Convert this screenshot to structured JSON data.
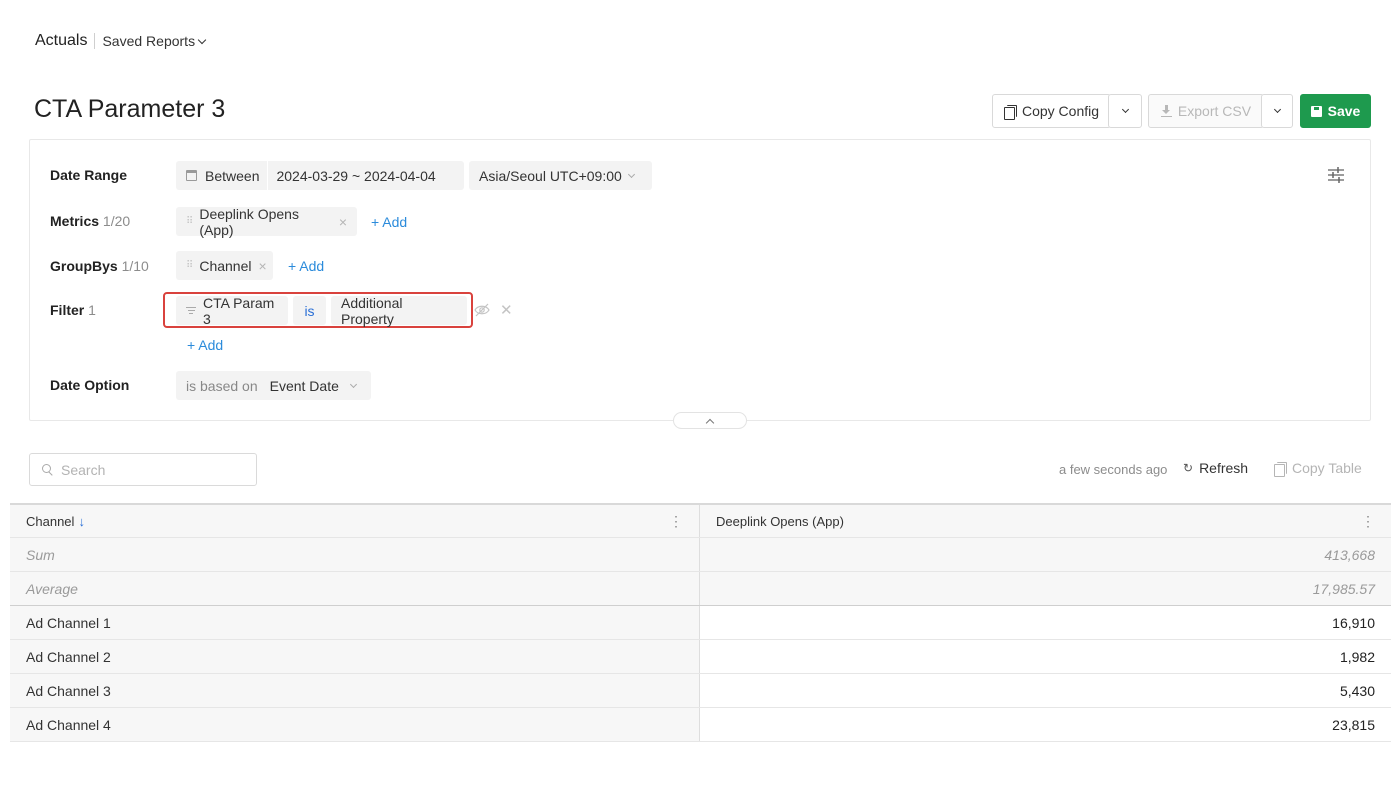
{
  "breadcrumb": {
    "main": "Actuals",
    "saved_reports": "Saved Reports"
  },
  "page_title": "CTA Parameter 3",
  "toolbar": {
    "copy_config": "Copy Config",
    "export_csv": "Export CSV",
    "save": "Save"
  },
  "config": {
    "date_range": {
      "label": "Date Range",
      "mode": "Between",
      "range": "2024-03-29 ~ 2024-04-04",
      "timezone": "Asia/Seoul UTC+09:00"
    },
    "metrics": {
      "label": "Metrics",
      "count": "1/20",
      "items": [
        "Deeplink Opens (App)"
      ],
      "add": "+ Add"
    },
    "groupbys": {
      "label": "GroupBys",
      "count": "1/10",
      "items": [
        "Channel"
      ],
      "add": "+ Add"
    },
    "filter": {
      "label": "Filter",
      "count": "1",
      "field": "CTA Param 3",
      "operator": "is",
      "value": "Additional Property",
      "add": "+ Add"
    },
    "date_option": {
      "label": "Date Option",
      "prefix": "is based on",
      "value": "Event Date"
    }
  },
  "search": {
    "placeholder": "Search"
  },
  "status": {
    "updated": "a few seconds ago",
    "refresh": "Refresh",
    "copy_table": "Copy Table"
  },
  "table": {
    "columns": [
      "Channel",
      "Deeplink Opens (App)"
    ],
    "aggregates": [
      {
        "label": "Sum",
        "value": "413,668"
      },
      {
        "label": "Average",
        "value": "17,985.57"
      }
    ],
    "rows": [
      {
        "channel": "Ad Channel 1",
        "value": "16,910"
      },
      {
        "channel": "Ad Channel 2",
        "value": "1,982"
      },
      {
        "channel": "Ad Channel 3",
        "value": "5,430"
      },
      {
        "channel": "Ad Channel 4",
        "value": "23,815"
      }
    ]
  },
  "colors": {
    "save_green": "#1e9a4e",
    "link_blue": "#2b8bdb",
    "highlight_red": "#d9423d"
  }
}
